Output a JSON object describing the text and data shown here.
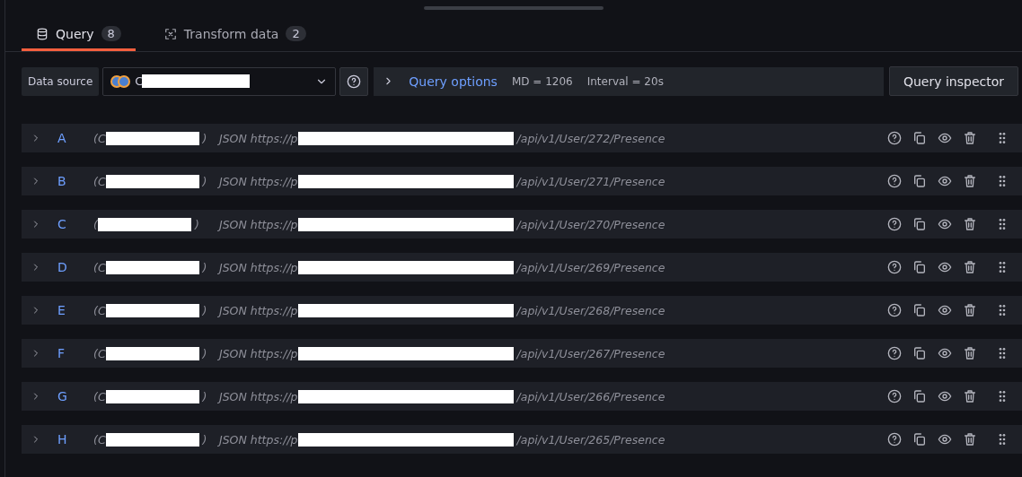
{
  "tabs": [
    {
      "label": "Query",
      "count": "8",
      "selected": true
    },
    {
      "label": "Transform data",
      "count": "2",
      "selected": false
    }
  ],
  "toolbar": {
    "data_source_label": "Data source",
    "data_source_value_prefix": "C",
    "query_options": "Query options",
    "md": "MD = 1206",
    "interval": "Interval = 20s",
    "inspector": "Query inspector"
  },
  "queries": [
    {
      "ref": "A",
      "name_prefix": "(C",
      "name_suffix": ")",
      "url_prefix": "JSON https://p",
      "url_suffix": "/api/v1/User/272/Presence"
    },
    {
      "ref": "B",
      "name_prefix": "(C",
      "name_suffix": ")",
      "url_prefix": "JSON https://p",
      "url_suffix": "/api/v1/User/271/Presence"
    },
    {
      "ref": "C",
      "name_prefix": "(",
      "name_suffix": ")",
      "url_prefix": "JSON https://p",
      "url_suffix": "/api/v1/User/270/Presence"
    },
    {
      "ref": "D",
      "name_prefix": "(C",
      "name_suffix": ")",
      "url_prefix": "JSON https://p",
      "url_suffix": "/api/v1/User/269/Presence"
    },
    {
      "ref": "E",
      "name_prefix": "(C",
      "name_suffix": ")",
      "url_prefix": "JSON https://p",
      "url_suffix": "/api/v1/User/268/Presence"
    },
    {
      "ref": "F",
      "name_prefix": "(C",
      "name_suffix": ")",
      "url_prefix": "JSON https://p",
      "url_suffix": "/api/v1/User/267/Presence"
    },
    {
      "ref": "G",
      "name_prefix": "(C",
      "name_suffix": ")",
      "url_prefix": "JSON https://p",
      "url_suffix": "/api/v1/User/266/Presence"
    },
    {
      "ref": "H",
      "name_prefix": "(C",
      "name_suffix": ")",
      "url_prefix": "JSON https://p",
      "url_suffix": "/api/v1/User/265/Presence"
    }
  ]
}
